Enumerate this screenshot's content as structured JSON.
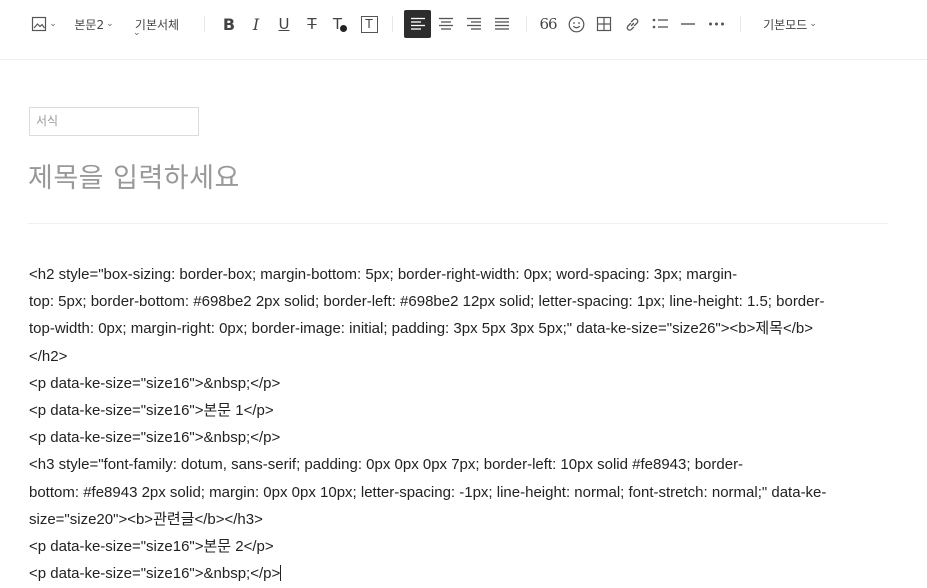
{
  "toolbar": {
    "image_icon": "image-icon",
    "paragraph_style": "본문2",
    "font_family": "기본서체",
    "bold_label": "B",
    "italic_label": "I",
    "underline_label": "U",
    "strike_label": "T",
    "text_color_label": "T",
    "bg_color_label": "T",
    "quote_label": "66",
    "mode_label": "기본모드"
  },
  "editor": {
    "category_placeholder": "서식",
    "title_placeholder": "제목을 입력하세요",
    "lines": [
      "<h2 style=\"box-sizing: border-box; margin-bottom: 5px; border-right-width: 0px; word-spacing: 3px; margin-",
      "top: 5px; border-bottom: #698be2 2px solid; border-left: #698be2 12px solid; letter-spacing: 1px; line-height: 1.5; border-",
      "top-width: 0px; margin-right: 0px; border-image: initial; padding: 3px 5px 3px 5px;\" data-ke-size=\"size26\"><b>제목</b>",
      "</h2>",
      "<p data-ke-size=\"size16\">&nbsp;</p>",
      "<p data-ke-size=\"size16\">본문 1</p>",
      "<p data-ke-size=\"size16\">&nbsp;</p>",
      "<h3 style=\"font-family: dotum, sans-serif; padding: 0px 0px 0px 7px; border-left: 10px solid #fe8943; border-",
      "bottom: #fe8943 2px solid; margin: 0px 0px 10px; letter-spacing: -1px; line-height: normal; font-stretch: normal;\" data-ke-",
      "size=\"size20\"><b>관련글</b></h3>",
      "<p data-ke-size=\"size16\">본문 2</p>",
      "<p data-ke-size=\"size16\">&nbsp;</p>"
    ]
  }
}
